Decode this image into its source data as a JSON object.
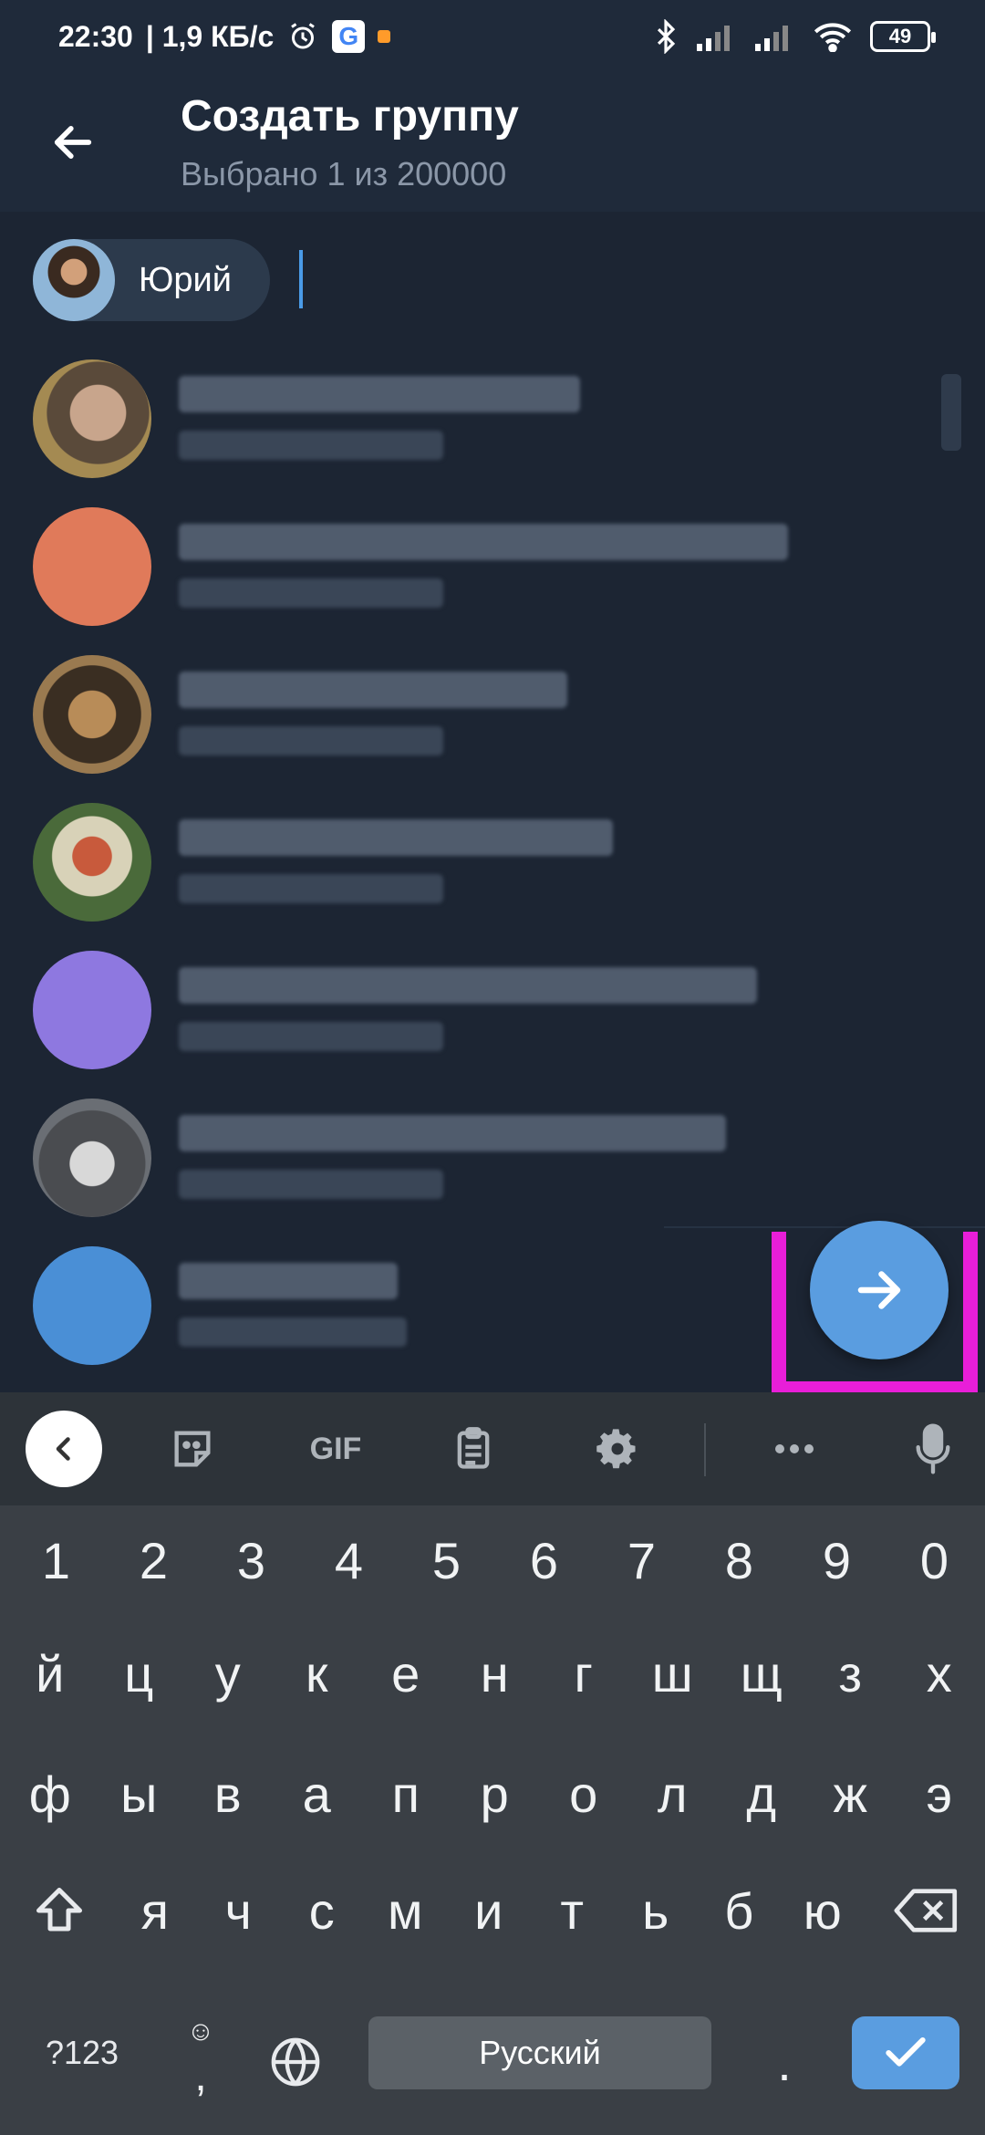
{
  "status_bar": {
    "time": "22:30",
    "speed": "| 1,9 КБ/с",
    "battery": "49",
    "icons": [
      "alarm-icon",
      "google-icon",
      "notification-dot-icon",
      "bluetooth-icon",
      "signal-icon",
      "signal-icon",
      "wifi-icon",
      "battery-icon"
    ]
  },
  "header": {
    "title": "Создать группу",
    "subtitle": "Выбрано 1 из 200000",
    "back_icon": "arrow-left-icon"
  },
  "selected": {
    "chip_label": "Юрий"
  },
  "contacts": {
    "count_visible": 7,
    "avatar_colors": [
      "#8a7560",
      "#e07a5a",
      "#7a6040",
      "#6b7a55",
      "#8e78e0",
      "#6a6e74",
      "#4a8fd6"
    ]
  },
  "fab": {
    "icon": "arrow-right-icon",
    "highlight_color": "#e81ed8",
    "color": "#5a9de0"
  },
  "keyboard": {
    "toolbar": [
      "chevron-left-icon",
      "sticker-icon",
      "GIF",
      "clipboard-icon",
      "gear-icon",
      "more-icon",
      "microphone-icon"
    ],
    "gif_label": "GIF",
    "row_numbers": [
      "1",
      "2",
      "3",
      "4",
      "5",
      "6",
      "7",
      "8",
      "9",
      "0"
    ],
    "row1": [
      "й",
      "ц",
      "у",
      "к",
      "е",
      "н",
      "г",
      "ш",
      "щ",
      "з",
      "х"
    ],
    "row2": [
      "ф",
      "ы",
      "в",
      "а",
      "п",
      "р",
      "о",
      "л",
      "д",
      "ж",
      "э"
    ],
    "row3": [
      "я",
      "ч",
      "с",
      "м",
      "и",
      "т",
      "ь",
      "б",
      "ю"
    ],
    "mode_key": "?123",
    "comma_key": ",",
    "period_key": ".",
    "space_label": "Русский",
    "accent_color": "#5a9de0"
  }
}
